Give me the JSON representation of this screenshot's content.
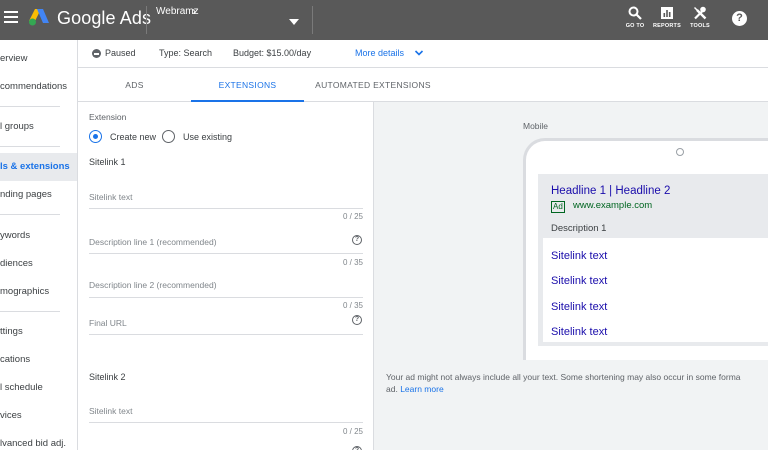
{
  "header": {
    "brand": "Google Ads",
    "account": "Webramz",
    "tools": [
      {
        "label": "GO TO",
        "icon": "search-icon"
      },
      {
        "label": "REPORTS",
        "icon": "reports-icon"
      },
      {
        "label": "TOOLS",
        "icon": "wrench-icon"
      }
    ],
    "help_glyph": "?"
  },
  "nav": {
    "items": [
      "erview",
      "commendations",
      "l groups",
      "ls & extensions",
      "nding pages",
      "ywords",
      "diences",
      "mographics",
      "ttings",
      "cations",
      "l schedule",
      "vices",
      "lvanced bid adj."
    ],
    "active_index": 3
  },
  "status": {
    "state": "Paused",
    "type": "Type: Search",
    "budget": "Budget: $15.00/day",
    "more_details": "More details"
  },
  "tabs": {
    "items": [
      "ADS",
      "EXTENSIONS",
      "AUTOMATED EXTENSIONS"
    ],
    "active_index": 1
  },
  "form": {
    "extension_label": "Extension",
    "option_create": "Create new",
    "option_existing": "Use existing",
    "selected_option": "Create new",
    "sitelink1": {
      "title": "Sitelink 1",
      "text_ph": "Sitelink text",
      "text_count": "0 / 25",
      "desc1_ph": "Description line 1 (recommended)",
      "desc1_count": "0 / 35",
      "desc2_ph": "Description line 2 (recommended)",
      "desc2_count": "0 / 35",
      "url_ph": "Final URL"
    },
    "sitelink2": {
      "title": "Sitelink 2",
      "text_ph": "Sitelink text",
      "text_count": "0 / 25"
    }
  },
  "preview": {
    "device_label": "Mobile",
    "headline": "Headline 1 | Headline 2",
    "ad_badge": "Ad",
    "display_url": "www.example.com",
    "description": "Description 1",
    "sitelinks": [
      "Sitelink text",
      "Sitelink text",
      "Sitelink text",
      "Sitelink text"
    ],
    "disclaimer_line1": "Your ad might not always include all your text. Some shortening may also occur in some forma",
    "disclaimer_line2": "ad.",
    "learn_more": "Learn more"
  },
  "colors": {
    "topbar": "#595959",
    "accent": "#1a73e8",
    "link": "#1a0dab",
    "url_green": "#006621"
  }
}
